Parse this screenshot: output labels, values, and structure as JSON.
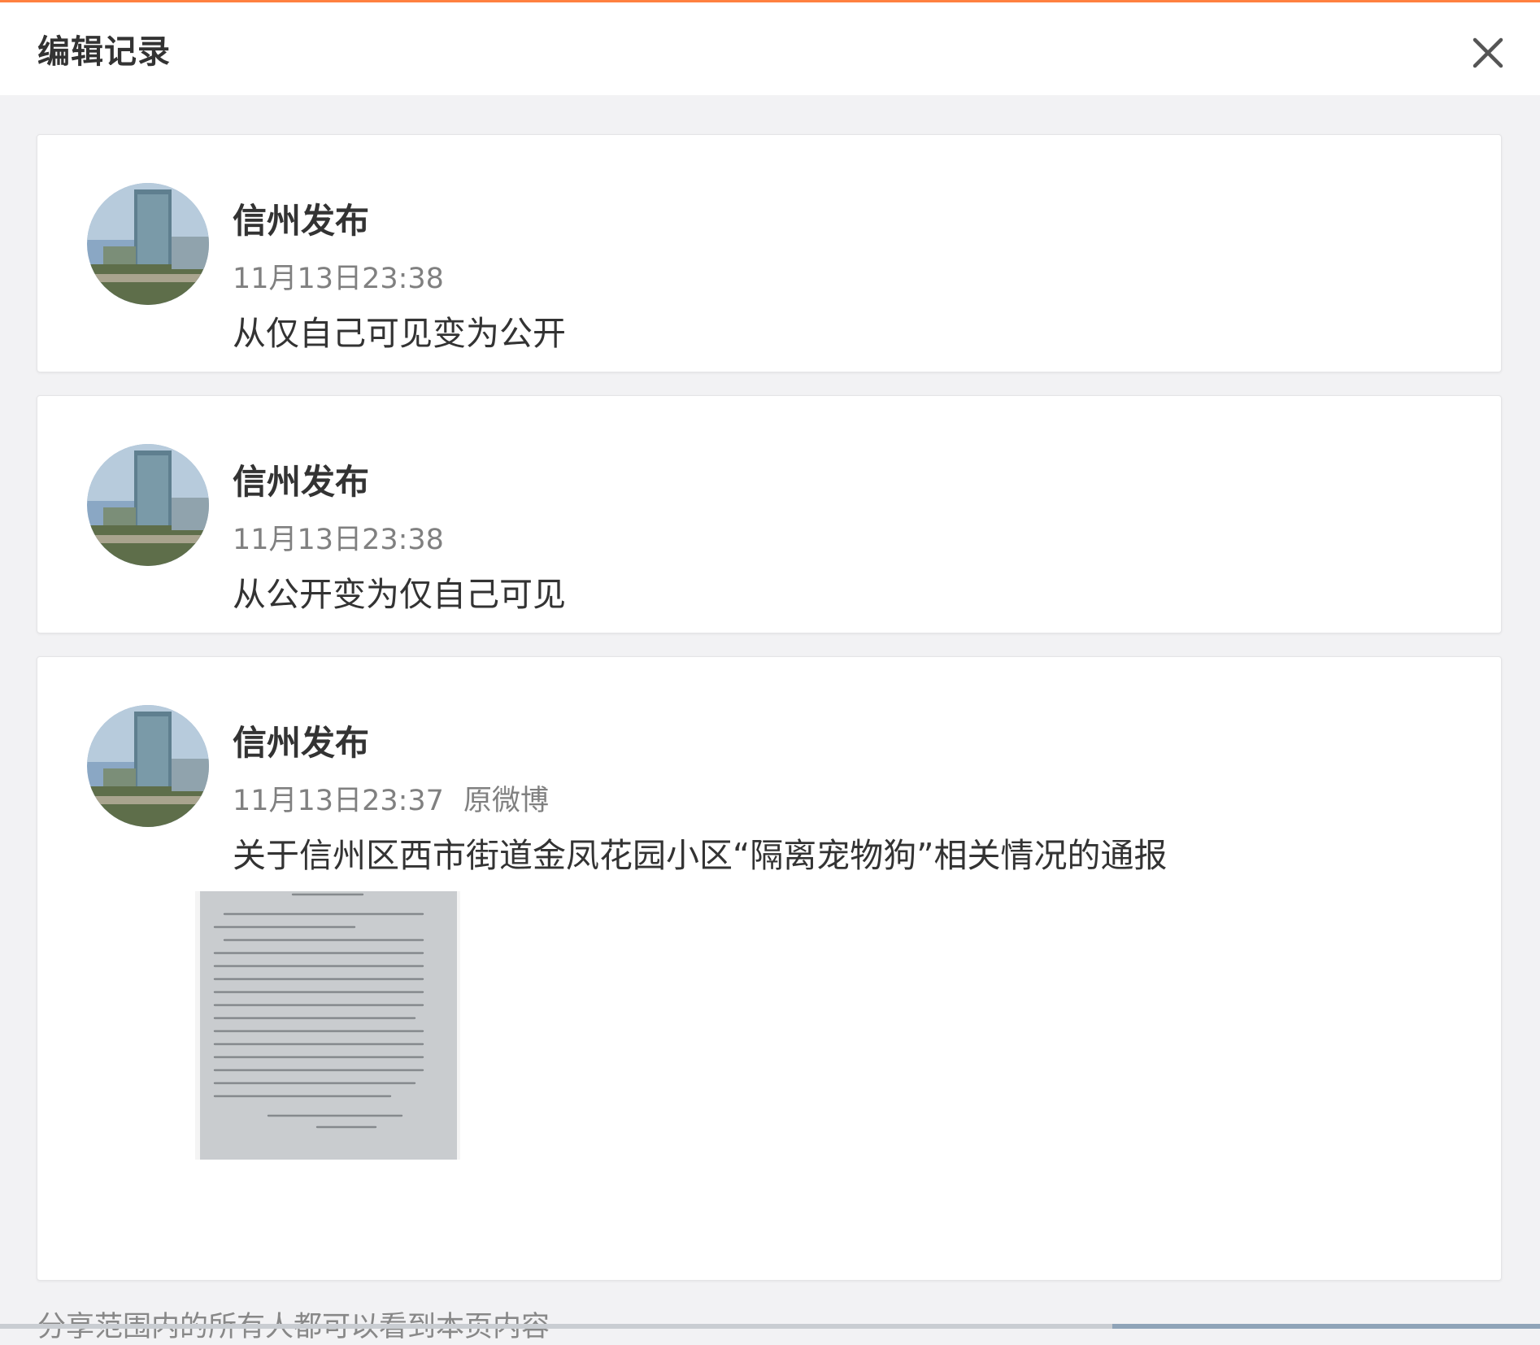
{
  "header": {
    "title": "编辑记录",
    "close_icon": "close-icon"
  },
  "records": [
    {
      "author": "信州发布",
      "time": "11月13日23:38",
      "text": "从仅自己可见变为公开"
    },
    {
      "author": "信州发布",
      "time": "11月13日23:38",
      "text": "从公开变为仅自己可见"
    },
    {
      "author": "信州发布",
      "time": "11月13日23:37",
      "origin_link": "原微博",
      "text": "关于信州区西市街道金凤花园小区“隔离宠物狗”相关情况的通报"
    }
  ],
  "footer": {
    "note": "分享范围内的所有人都可以看到本页内容"
  },
  "colors": {
    "accent_top_bar": "#ff8140",
    "background": "#f2f2f4",
    "card": "#ffffff",
    "title_text": "#333333",
    "meta_text": "#808080"
  }
}
